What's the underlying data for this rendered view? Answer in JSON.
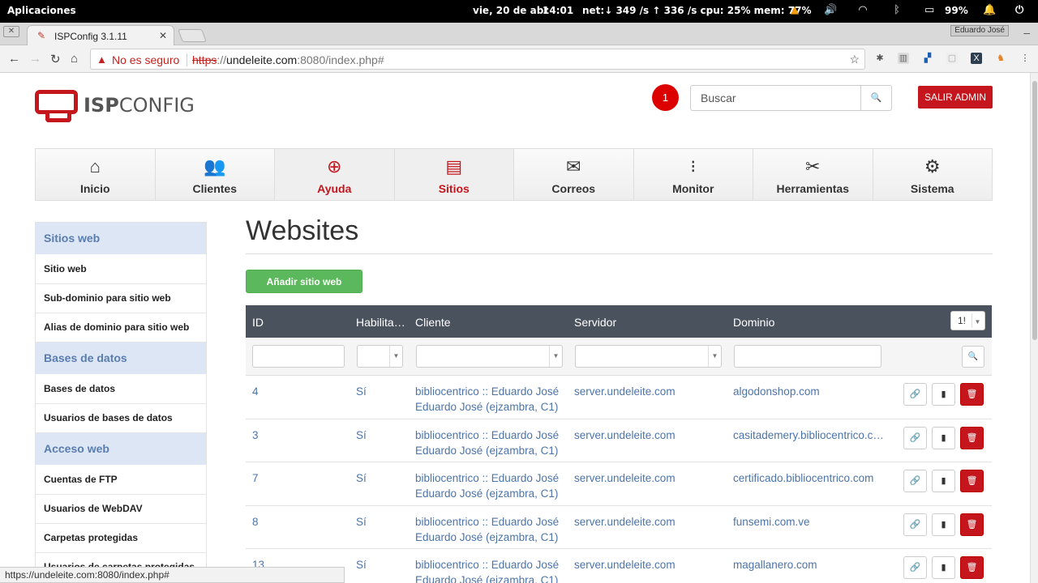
{
  "system": {
    "apps": "Aplicaciones",
    "date": "vie, 20 de abr",
    "time": "14:01",
    "net": "net:↓ 349  /s ↑ 336  /s cpu: 25% mem: 77%",
    "battery": "99%"
  },
  "browser": {
    "tab_title": "ISPConfig 3.1.11",
    "user_badge": "Eduardo José",
    "insecure_label": "No es seguro",
    "url_scheme": "https",
    "url_sep": "://",
    "url_host": "undeleite.com",
    "url_rest": ":8080/index.php#",
    "status_url": "https://undeleite.com:8080/index.php#"
  },
  "header": {
    "logo_a": "ISP",
    "logo_b": "CONFIG",
    "notification_count": "1",
    "search_placeholder": "Buscar",
    "logout_label": "SALIR ADMIN"
  },
  "main_tabs": [
    {
      "label": "Inicio",
      "icon": "home-icon"
    },
    {
      "label": "Clientes",
      "icon": "users-icon"
    },
    {
      "label": "Ayuda",
      "icon": "lifebuoy-icon"
    },
    {
      "label": "Sitios",
      "icon": "sites-icon"
    },
    {
      "label": "Correos",
      "icon": "mail-icon"
    },
    {
      "label": "Monitor",
      "icon": "traffic-light-icon"
    },
    {
      "label": "Herramientas",
      "icon": "tools-icon"
    },
    {
      "label": "Sistema",
      "icon": "gear-icon"
    }
  ],
  "sidebar": {
    "sections": [
      {
        "title": "Sitios web",
        "items": [
          "Sitio web",
          "Sub-dominio para sitio web",
          "Alias de dominio para sitio web"
        ]
      },
      {
        "title": "Bases de datos",
        "items": [
          "Bases de datos",
          "Usuarios de bases de datos"
        ]
      },
      {
        "title": "Acceso web",
        "items": [
          "Cuentas de FTP",
          "Usuarios de WebDAV",
          "Carpetas protegidas",
          "Usuarios de carpetas protegidas"
        ]
      }
    ]
  },
  "content": {
    "title": "Websites",
    "add_button": "Añadir sitio web",
    "pager_value": "1!",
    "columns": [
      "ID",
      "Habilita…",
      "Cliente",
      "Servidor",
      "Dominio"
    ],
    "rows": [
      {
        "id": "4",
        "enabled": "Sí",
        "client_1": "bibliocentrico :: Eduardo José",
        "client_2": "Eduardo José (ejzambra, C1)",
        "server": "server.undeleite.com",
        "domain": "algodonshop.com"
      },
      {
        "id": "3",
        "enabled": "Sí",
        "client_1": "bibliocentrico :: Eduardo José",
        "client_2": "Eduardo José (ejzambra, C1)",
        "server": "server.undeleite.com",
        "domain": "casitademery.bibliocentrico.c…"
      },
      {
        "id": "7",
        "enabled": "Sí",
        "client_1": "bibliocentrico :: Eduardo José",
        "client_2": "Eduardo José (ejzambra, C1)",
        "server": "server.undeleite.com",
        "domain": "certificado.bibliocentrico.com"
      },
      {
        "id": "8",
        "enabled": "Sí",
        "client_1": "bibliocentrico :: Eduardo José",
        "client_2": "Eduardo José (ejzambra, C1)",
        "server": "server.undeleite.com",
        "domain": "funsemi.com.ve"
      },
      {
        "id": "13",
        "enabled": "Sí",
        "client_1": "bibliocentrico :: Eduardo José",
        "client_2": "Eduardo José (ejzambra, C1)",
        "server": "server.undeleite.com",
        "domain": "magallanero.com"
      }
    ]
  }
}
